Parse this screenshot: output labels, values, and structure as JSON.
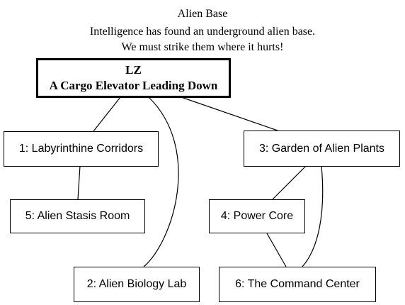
{
  "header": {
    "title": "Alien Base",
    "line1": "Intelligence has found an underground alien base.",
    "line2": "We must strike them where it hurts!"
  },
  "nodes": {
    "lz": {
      "code": "LZ",
      "label": "A Cargo Elevator Leading Down"
    },
    "n1": {
      "label": "1: Labyrinthine Corridors"
    },
    "n2": {
      "label": "2: Alien Biology Lab"
    },
    "n3": {
      "label": "3: Garden of Alien Plants"
    },
    "n4": {
      "label": "4: Power Core"
    },
    "n5": {
      "label": "5: Alien Stasis Room"
    },
    "n6": {
      "label": "6: The Command Center"
    }
  },
  "edges": [
    {
      "from": "LZ",
      "to": "1"
    },
    {
      "from": "LZ",
      "to": "2"
    },
    {
      "from": "LZ",
      "to": "3"
    },
    {
      "from": "1",
      "to": "5"
    },
    {
      "from": "3",
      "to": "4"
    },
    {
      "from": "3",
      "to": "6"
    },
    {
      "from": "4",
      "to": "6"
    }
  ]
}
